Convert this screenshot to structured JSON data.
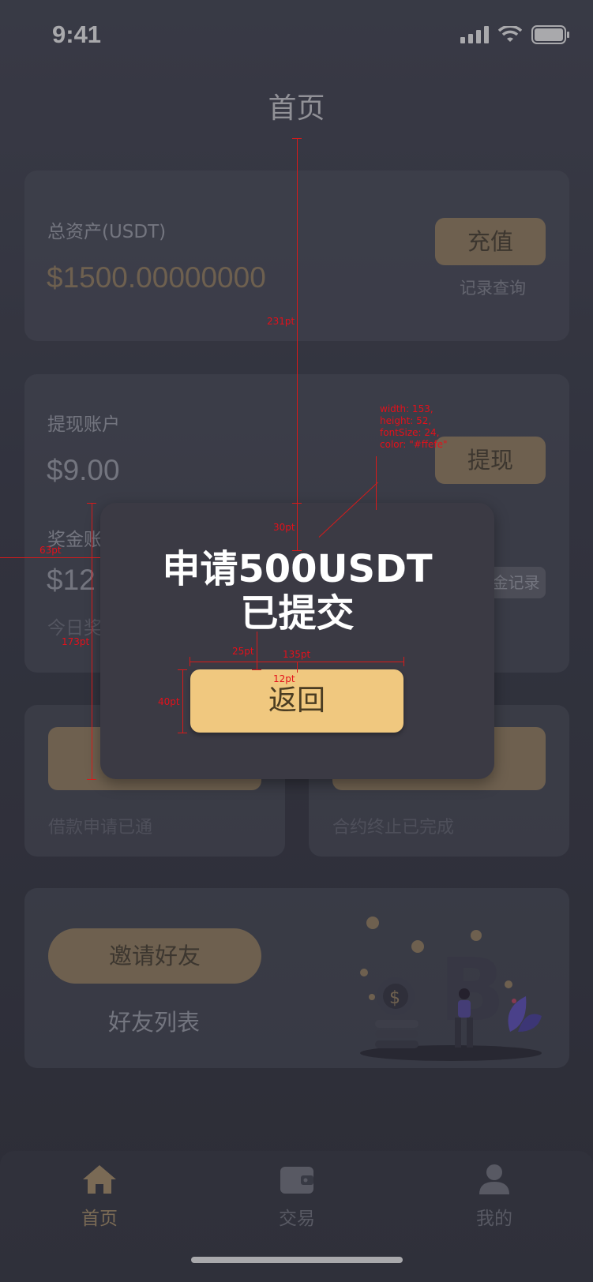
{
  "status_bar": {
    "time": "9:41"
  },
  "header": {
    "title": "首页"
  },
  "total_assets": {
    "label": "总资产(USDT)",
    "amount": "$1500.00000000",
    "deposit_button": "充值",
    "records_link": "记录查询"
  },
  "withdraw_account": {
    "label": "提现账户",
    "amount": "$9.00",
    "withdraw_button": "提现"
  },
  "bonus_account": {
    "label": "奖金账",
    "amount": "$12",
    "today_label": "今日奖",
    "records_button": "金记录"
  },
  "loan_card": {
    "status": "借款申请已通"
  },
  "contract_card": {
    "status": "合约终止已完成"
  },
  "invite": {
    "button": "邀请好友",
    "friends_list": "好友列表"
  },
  "dialog": {
    "message_line1": "申请500USDT",
    "message_line2": "已提交",
    "return_button": "返回"
  },
  "annotations": {
    "spec_width": "width: 153,",
    "spec_height": "height: 52,",
    "spec_fontsize": "fontSize: 24,",
    "spec_color": "color: \"#ffefe\"",
    "dist_231": "231pt",
    "dist_30": "30pt",
    "dist_25": "25pt",
    "dist_135": "135pt",
    "dist_12": "12pt",
    "dist_40": "40pt",
    "dist_63": "63pt",
    "dist_173": "173pt"
  },
  "tabs": [
    {
      "label": "首页",
      "icon": "home-icon",
      "active": true
    },
    {
      "label": "交易",
      "icon": "wallet-icon",
      "active": false
    },
    {
      "label": "我的",
      "icon": "user-icon",
      "active": false
    }
  ],
  "colors": {
    "accent": "#a08a69",
    "dialog_button": "#f0c87f",
    "active_tab": "#b39a73",
    "inactive_tab": "#7d7f8a"
  }
}
